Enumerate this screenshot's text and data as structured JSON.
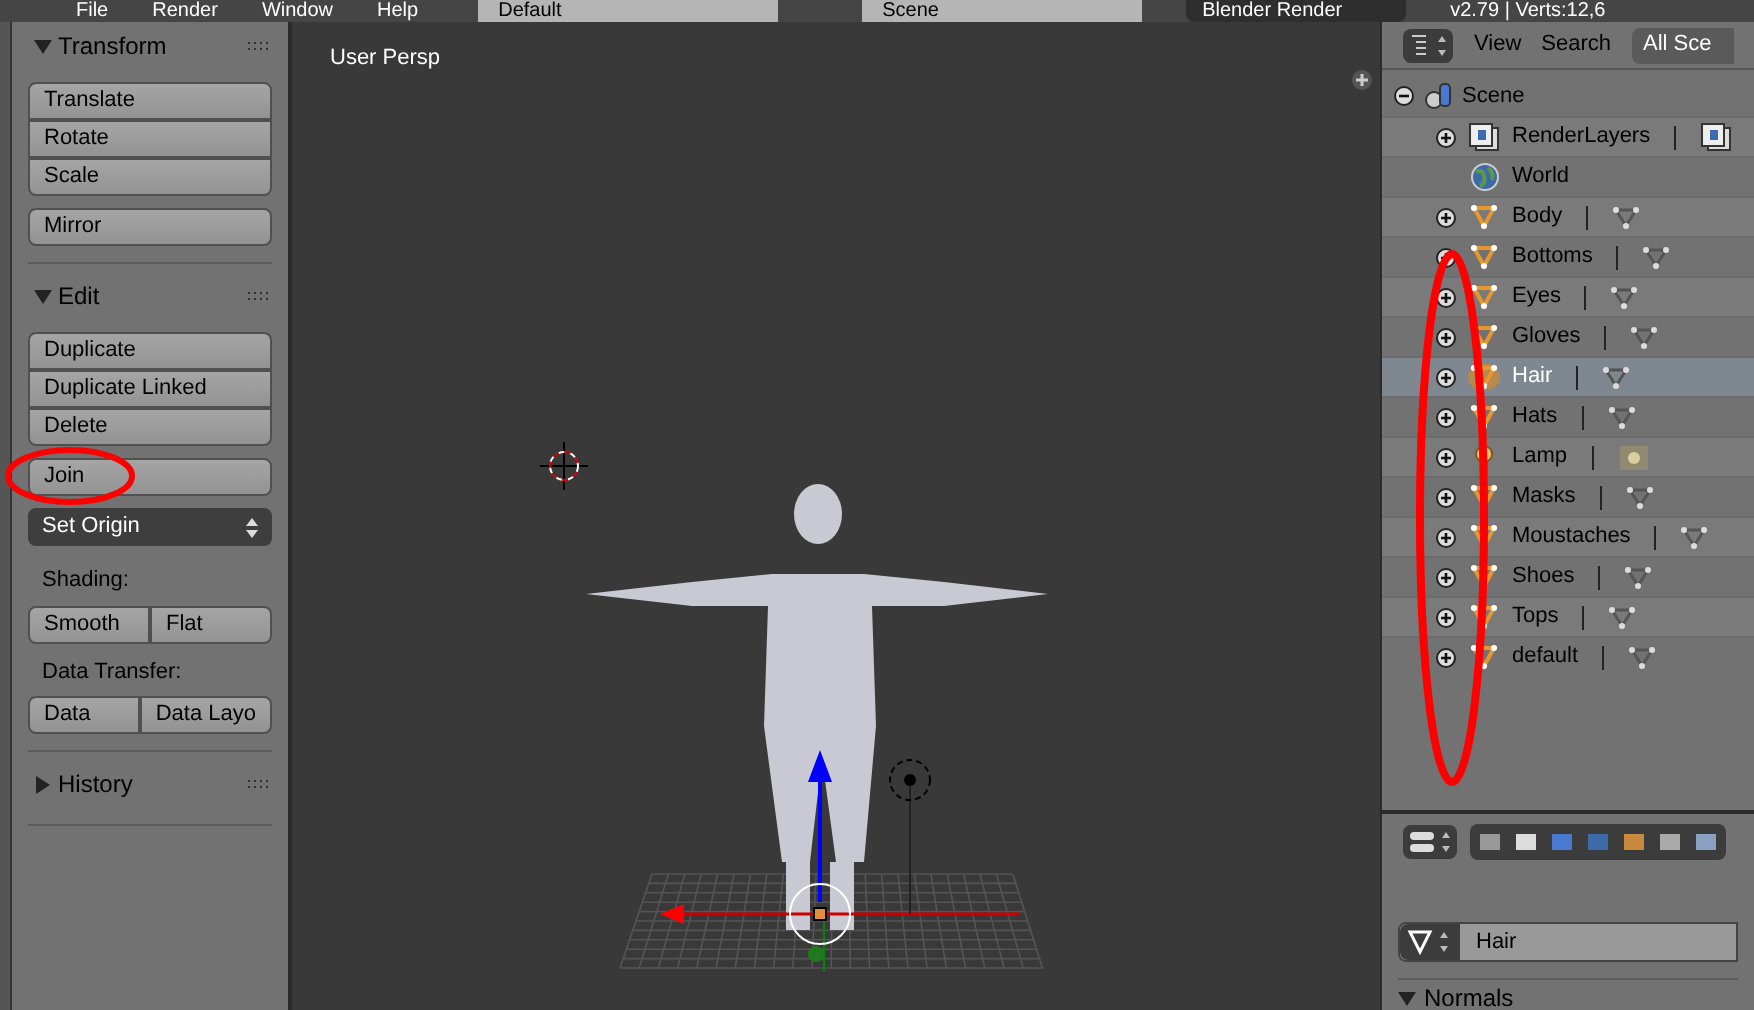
{
  "menu_bar": {
    "items": [
      "File",
      "Render",
      "Window",
      "Help"
    ],
    "layout": "Default",
    "scene": "Scene",
    "engine": "Blender Render",
    "stats": "v2.79 | Verts:12,6"
  },
  "tool_shelf": {
    "panels": [
      {
        "title": "Transform",
        "expanded": true,
        "controls": [
          {
            "kind": "stack",
            "buttons": [
              "Translate",
              "Rotate",
              "Scale"
            ]
          },
          {
            "kind": "stack",
            "buttons": [
              "Mirror"
            ]
          }
        ]
      },
      {
        "title": "Edit",
        "expanded": true,
        "controls": [
          {
            "kind": "stack",
            "buttons": [
              "Duplicate",
              "Duplicate Linked",
              "Delete"
            ]
          },
          {
            "kind": "stack",
            "buttons": [
              "Join"
            ]
          },
          {
            "kind": "dropdown",
            "value": "Set Origin"
          },
          {
            "kind": "label",
            "text": "Shading:"
          },
          {
            "kind": "row",
            "buttons": [
              "Smooth",
              "Flat"
            ]
          },
          {
            "kind": "label",
            "text": "Data Transfer:"
          },
          {
            "kind": "row",
            "buttons": [
              "Data",
              "Data Layo"
            ]
          }
        ]
      },
      {
        "title": "History",
        "expanded": false
      }
    ]
  },
  "viewport": {
    "label": "User Persp"
  },
  "outliner": {
    "header": {
      "view": "View",
      "search": "Search",
      "filter": "All Sce"
    },
    "tree": {
      "name": "Scene",
      "expanded": true,
      "children": [
        {
          "name": "RenderLayers",
          "kind": "renderlayers",
          "selected": false,
          "expanded": false
        },
        {
          "name": "World",
          "kind": "world",
          "selected": false
        },
        {
          "name": "Body",
          "kind": "mesh",
          "selected": false,
          "expanded": false
        },
        {
          "name": "Bottoms",
          "kind": "mesh",
          "selected": false,
          "expanded": false
        },
        {
          "name": "Eyes",
          "kind": "mesh",
          "selected": false,
          "expanded": false
        },
        {
          "name": "Gloves",
          "kind": "mesh",
          "selected": false,
          "expanded": false
        },
        {
          "name": "Hair",
          "kind": "mesh",
          "selected": true,
          "expanded": false
        },
        {
          "name": "Hats",
          "kind": "mesh",
          "selected": false,
          "expanded": false
        },
        {
          "name": "Lamp",
          "kind": "lamp",
          "selected": false,
          "expanded": false
        },
        {
          "name": "Masks",
          "kind": "mesh",
          "selected": false,
          "expanded": false
        },
        {
          "name": "Moustaches",
          "kind": "mesh",
          "selected": false,
          "expanded": false
        },
        {
          "name": "Shoes",
          "kind": "mesh",
          "selected": false,
          "expanded": false
        },
        {
          "name": "Tops",
          "kind": "mesh",
          "selected": false,
          "expanded": false
        },
        {
          "name": "default",
          "kind": "mesh",
          "selected": false,
          "expanded": false
        }
      ]
    }
  },
  "properties": {
    "mesh_name": "Hair",
    "panel": {
      "title": "Normals",
      "expanded": true
    }
  }
}
